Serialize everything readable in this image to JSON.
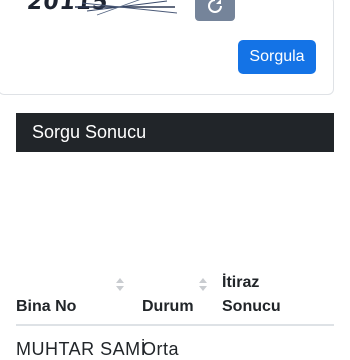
{
  "captcha": {
    "text": "20115"
  },
  "query_form": {
    "submit_label": "Sorgula"
  },
  "result": {
    "header_title": "Sorgu Sonucu",
    "columns": [
      "Bina No",
      "Durum",
      "İtiraz",
      "Sonucu"
    ],
    "rows": [
      {
        "bina_no": "MUHTAR SAMİ",
        "durum": "Orta"
      }
    ]
  },
  "colors": {
    "primary": "#1473e6",
    "header_bg": "#212529",
    "refresh_bg": "#75849a"
  }
}
